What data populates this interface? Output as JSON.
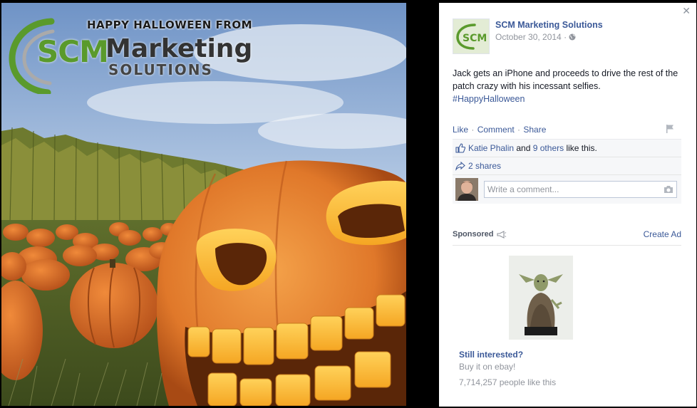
{
  "photo": {
    "logo": {
      "happy": "HAPPY HALLOWEEN FROM",
      "scm": "SCM",
      "marketing": "Marketing",
      "solutions": "SOLUTIONS"
    }
  },
  "post": {
    "page_name": "SCM Marketing Solutions",
    "date": "October 30, 2014",
    "date_sep": " · ",
    "text": "Jack gets an iPhone and proceeds to drive the rest of the patch crazy with his incessant selfies.",
    "hashtag": "#HappyHalloween",
    "avatar_text": "SCM"
  },
  "actions": {
    "like": "Like",
    "comment": "Comment",
    "share": "Share",
    "sep": " · "
  },
  "ufi": {
    "liker": "Katie Phalin",
    "and": " and ",
    "others": "9 others",
    "like_this": " like this.",
    "shares": "2 shares",
    "comment_placeholder": "Write a comment..."
  },
  "sponsored": {
    "label": "Sponsored",
    "create_ad": "Create Ad",
    "ad_title": "Still interested?",
    "ad_sub": "Buy it on ebay!",
    "ad_likes": "7,714,257 people like this"
  },
  "icons": {
    "close": "close-icon",
    "globe": "globe-icon",
    "flag": "flag-icon",
    "thumb": "thumbs-up-icon",
    "share": "share-arrow-icon",
    "camera": "camera-icon",
    "megaphone": "megaphone-icon"
  },
  "colors": {
    "link": "#3b5998",
    "muted": "#90949c",
    "brand_green": "#5a9a2c",
    "pumpkin": "#e8822a"
  }
}
